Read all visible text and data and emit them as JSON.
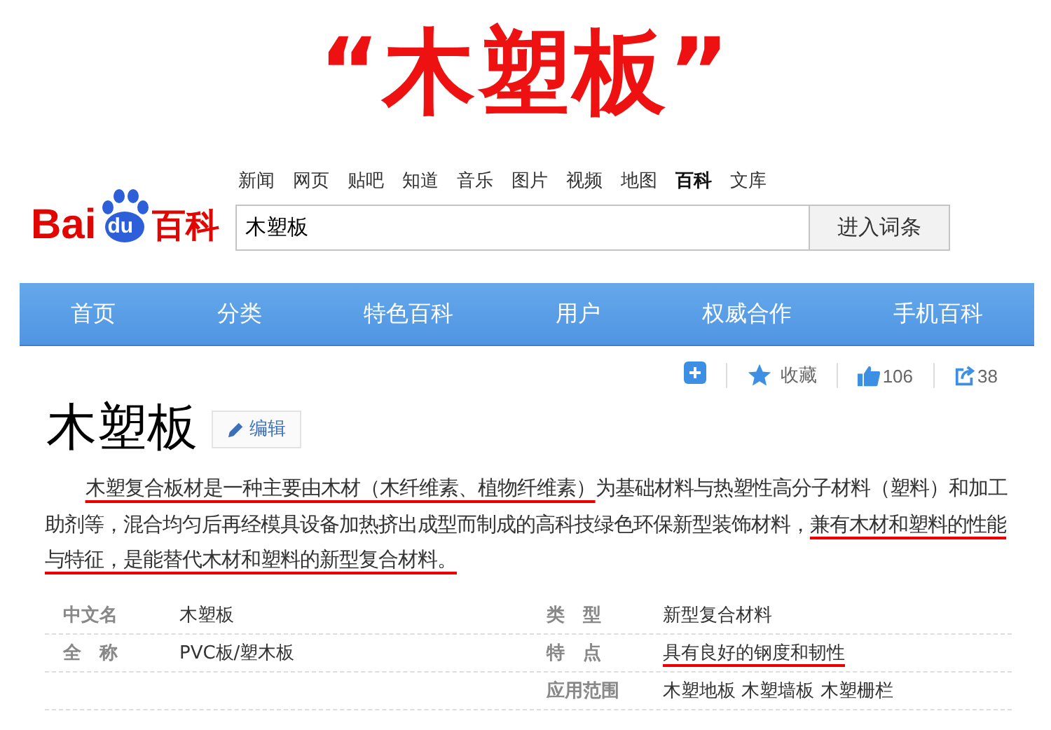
{
  "banner_title": "“木塑板”",
  "top_links": [
    {
      "label": "新闻",
      "selected": false
    },
    {
      "label": "网页",
      "selected": false
    },
    {
      "label": "贴吧",
      "selected": false
    },
    {
      "label": "知道",
      "selected": false
    },
    {
      "label": "音乐",
      "selected": false
    },
    {
      "label": "图片",
      "selected": false
    },
    {
      "label": "视频",
      "selected": false
    },
    {
      "label": "地图",
      "selected": false
    },
    {
      "label": "百科",
      "selected": true
    },
    {
      "label": "文库",
      "selected": false
    }
  ],
  "logo": {
    "part_1": "Bai",
    "paw_text": "du",
    "part_2": "百科"
  },
  "search": {
    "value": "木塑板",
    "button": "进入词条"
  },
  "nav": [
    "首页",
    "分类",
    "特色百科",
    "用户",
    "权威合作",
    "手机百科"
  ],
  "actions": {
    "collect": "收藏",
    "likes": "106",
    "shares": "38"
  },
  "heading": "木塑板",
  "edit_button": "编辑",
  "paragraph": [
    {
      "text": "木塑复合板材是一种主要由木材（木纤维素、植物纤维素）",
      "underlined": true
    },
    {
      "text": "为基础材料与热塑性高分子材料（塑料）和加工助剂等，混合均匀后再经模具设备加热挤出成型而制成的高科技绿色环保新型装饰材料，",
      "underlined": false
    },
    {
      "text": "兼有木材和塑料的性能与特征，是能替代木材和塑料的新型复合材料。",
      "underlined": true
    }
  ],
  "info_rows": [
    {
      "label_1": "中文名",
      "value_1": "木塑板",
      "value_1_underlined": false,
      "label_2": "类　型",
      "value_2": "新型复合材料",
      "value_2_underlined": false
    },
    {
      "label_1": "全　称",
      "value_1": "PVC板/塑木板",
      "value_1_underlined": false,
      "label_2": "特　点",
      "value_2": "具有良好的钢度和韧性",
      "value_2_underlined": true
    },
    {
      "label_2": "应用范围",
      "value_2": "木塑地板 木塑墙板 木塑栅栏",
      "value_2_underlined": false
    }
  ]
}
